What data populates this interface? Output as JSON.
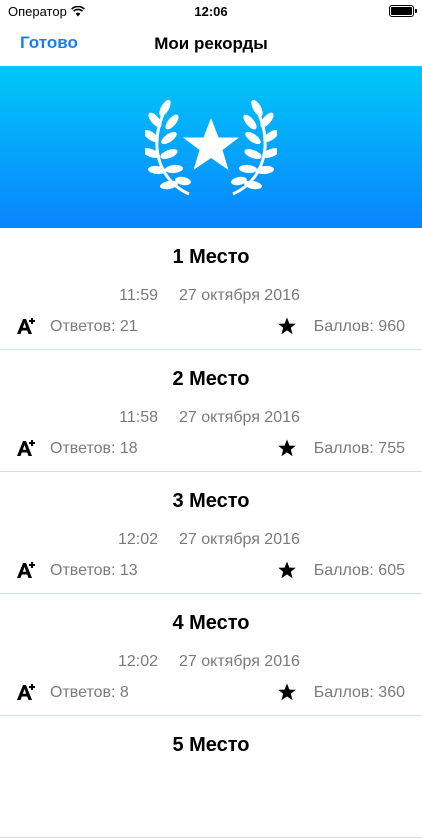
{
  "status_bar": {
    "carrier": "Оператор",
    "time": "12:06"
  },
  "nav": {
    "done_label": "Готово",
    "title": "Мои рекорды"
  },
  "colors": {
    "accent": "#1a7ef0",
    "banner_top": "#00c8f8",
    "banner_bottom": "#0a84ff"
  },
  "icons": {
    "banner": "laurel-star-icon",
    "answers": "a-plus-icon",
    "score": "star-icon"
  },
  "records": [
    {
      "place": "1 Место",
      "time": "11:59",
      "date": "27 октября 2016",
      "answers": "Ответов: 21",
      "score": "Баллов: 960"
    },
    {
      "place": "2 Место",
      "time": "11:58",
      "date": "27 октября 2016",
      "answers": "Ответов: 18",
      "score": "Баллов: 755"
    },
    {
      "place": "3 Место",
      "time": "12:02",
      "date": "27 октября 2016",
      "answers": "Ответов: 13",
      "score": "Баллов: 605"
    },
    {
      "place": "4 Место",
      "time": "12:02",
      "date": "27 октября 2016",
      "answers": "Ответов: 8",
      "score": "Баллов: 360"
    },
    {
      "place": "5 Место"
    }
  ]
}
